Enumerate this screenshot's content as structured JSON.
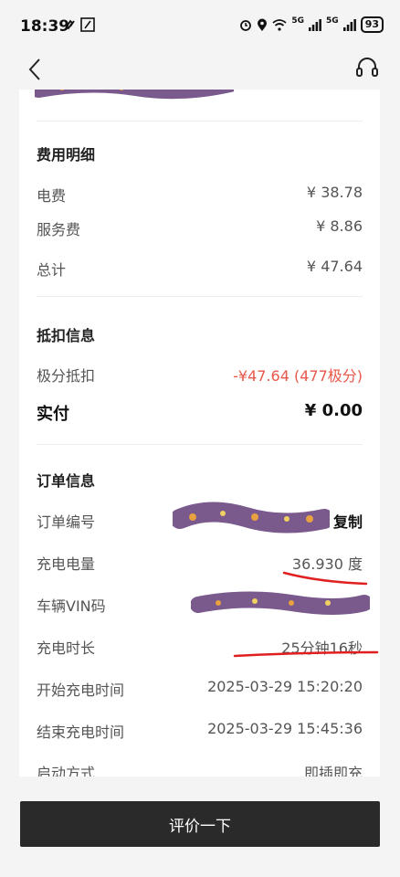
{
  "status_bar": {
    "time": "18:39",
    "net_1": "5G",
    "net_2": "5G",
    "battery": "93"
  },
  "nav": {
    "back_icon": "chevron-left-icon",
    "service_icon": "headset-icon"
  },
  "fees": {
    "title": "费用明细",
    "rows": [
      {
        "label": "电费",
        "value": "¥ 38.78"
      },
      {
        "label": "服务费",
        "value": "¥ 8.86"
      },
      {
        "label": "总计",
        "value": "¥ 47.64"
      }
    ]
  },
  "deduction": {
    "title": "抵扣信息",
    "points_label": "极分抵扣",
    "points_value": "-¥47.64 (477极分)",
    "paid_label": "实付",
    "paid_value": "¥ 0.00"
  },
  "order": {
    "title": "订单信息",
    "order_no_label": "订单编号",
    "copy_label": "复制",
    "energy_label": "充电电量",
    "energy_value": "36.930 度",
    "vin_label": "车辆VIN码",
    "duration_label": "充电时长",
    "duration_value": "25分钟16秒",
    "start_label": "开始充电时间",
    "start_value": "2025-03-29 15:20:20",
    "end_label": "结束充电时间",
    "end_value": "2025-03-29 15:45:36",
    "mode_label": "启动方式",
    "mode_value": "即插即充"
  },
  "footer": {
    "review_label": "评价一下"
  },
  "colors": {
    "accent_red": "#e8584a",
    "redaction_purple": "#7a5a8c",
    "button_dark": "#2a2a2a"
  }
}
